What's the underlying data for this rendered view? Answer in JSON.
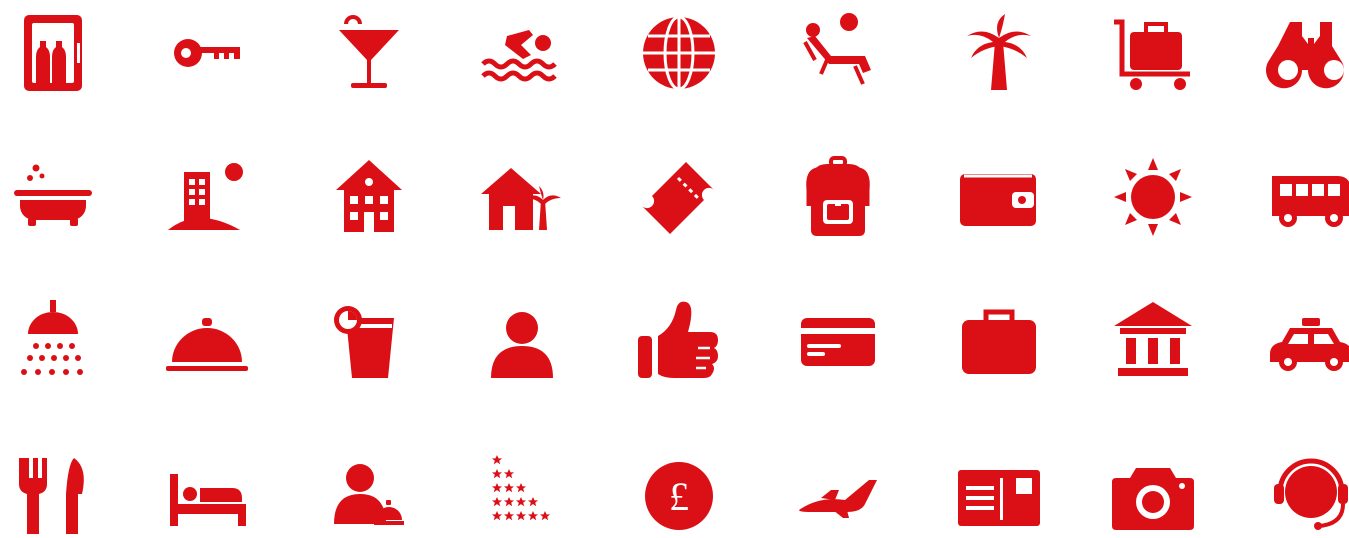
{
  "accent_color": "#db1016",
  "rows": [
    [
      "minibar-icon",
      "key-icon",
      "cocktail-icon",
      "swimming-icon",
      "globe-icon",
      "sunbathing-icon",
      "palm-tree-icon",
      "luggage-trolley-icon",
      "binoculars-icon"
    ],
    [
      "bathtub-icon",
      "resort-hotel-icon",
      "hotel-building-icon",
      "beach-house-icon",
      "ticket-icon",
      "backpack-icon",
      "wallet-icon",
      "sun-icon",
      "bus-icon"
    ],
    [
      "shower-icon",
      "room-service-cloche-icon",
      "juice-glass-icon",
      "user-icon",
      "thumbs-up-icon",
      "credit-card-icon",
      "briefcase-icon",
      "museum-icon",
      "taxi-icon"
    ],
    [
      "restaurant-icon",
      "bed-icon",
      "concierge-icon",
      "star-rating-icon",
      "pound-sterling-icon",
      "airplane-icon",
      "postcard-icon",
      "camera-icon",
      "support-headset-icon"
    ]
  ],
  "pound_symbol": "£"
}
